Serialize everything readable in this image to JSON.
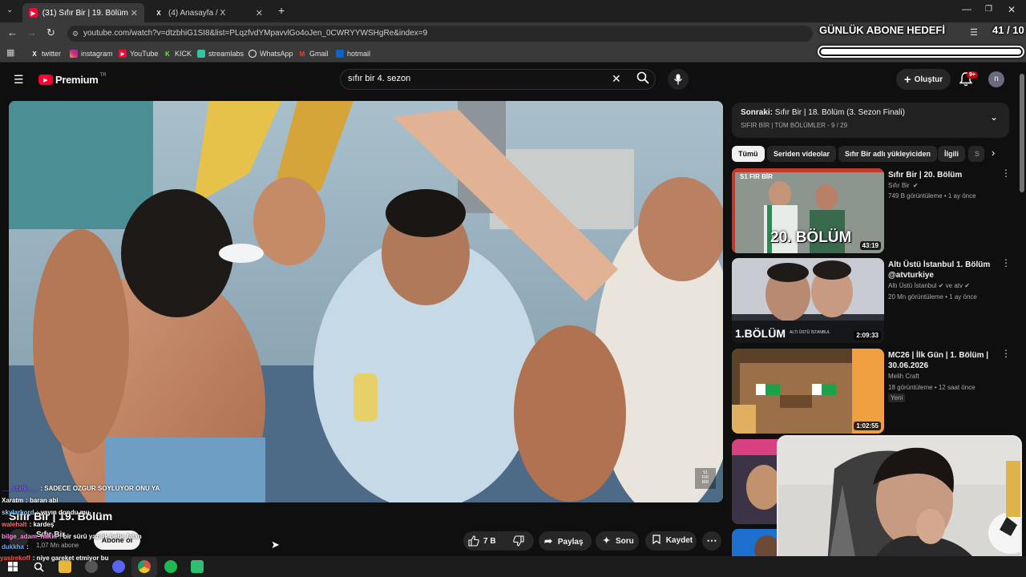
{
  "browser": {
    "tabs": [
      {
        "title": "(31) Sıfır Bir | 19. Bölüm - YouTu",
        "active": true
      },
      {
        "title": "(4) Anasayfa / X",
        "active": false
      }
    ],
    "url": "youtube.com/watch?v=dtzbhiG1SI8&list=PLqzfvdYMpavvlGo4oJen_0CWRYYWSHgRe&index=9",
    "bookmarks": [
      "twitter",
      "instagram",
      "YouTube",
      "KICK",
      "streamlabs",
      "WhatsApp",
      "Gmail",
      "hotmail"
    ]
  },
  "overlay": {
    "goal_label": "GÜNLÜK ABONE HEDEFİ",
    "goal_count": "41 / 10",
    "goal_progress": 1.0
  },
  "youtube": {
    "logo_text": "Premium",
    "logo_badge": "TR",
    "search_value": "sıfır bir 4. sezon",
    "create_label": "Oluştur",
    "notif_count": "9+",
    "avatar_letter": "n"
  },
  "video": {
    "watermark_line1": "S1",
    "watermark_line2": "FIR",
    "watermark_line3": "BİR",
    "title": "Sıfır Bir | 19. Bölüm",
    "channel": "Sıfır Bir",
    "subscribers": "1,07 Mn abone",
    "subscribe_label": "Abone ol",
    "likes": "7 B",
    "share_label": "Paylaş",
    "ask_label": "Soru",
    "save_label": "Kaydet"
  },
  "playlist": {
    "next_label": "Sonraki:",
    "next_title": "Sıfır Bir | 18. Bölüm (3. Sezon Finali)",
    "playlist_info": "SIFIR BİR | TÜM BÖLÜMLER - 9 / 29"
  },
  "chips": [
    "Tümü",
    "Seriden videolar",
    "Sıfır Bir adlı yükleyiciden",
    "İlgili",
    "S"
  ],
  "recommendations": [
    {
      "title": "Sıfır Bir | 20. Bölüm",
      "channel": "Sıfır Bir",
      "meta": "749 B görüntüleme • 1 ay önce",
      "duration": "43:19",
      "thumb_text": "20. BÖLÜM",
      "badge": ""
    },
    {
      "title": "Altı Üstü İstanbul 1. Bölüm @atvturkiye",
      "channel": "Altı Üstü İstanbul",
      "channel_suffix": "ve atv",
      "meta": "20 Mn görüntüleme • 1 ay önce",
      "duration": "2:09:33",
      "thumb_text": "1.BÖLÜM",
      "thumb_sub": "ALTI ÜSTÜ İSTANBUL",
      "badge": ""
    },
    {
      "title": "MC26 | İlk Gün | 1. Bölüm | 30.06.2026",
      "channel": "Melih Craft",
      "meta": "18 görüntüleme • 12 saat önce",
      "duration": "1:02:55",
      "thumb_text": "",
      "badge": "Yeni"
    }
  ],
  "chat": [
    {
      "user": "___xtxtk___",
      "msg": ": SADECE OZGUR SOYLUYOR ONU YA",
      "color": "#8a5cff"
    },
    {
      "user": "Xaratm",
      "msg": ": baran abi",
      "color": "#ffffff"
    },
    {
      "user": "skylarkord",
      "msg": ": yayın dondu mu",
      "color": "#7fd0ff"
    },
    {
      "user": "walehalt",
      "msg": ": kardeş",
      "color": "#ff6a6a"
    },
    {
      "user": "bilge_adam_hakkı",
      "msg": ": bir sürü yazılık bebe falan",
      "color": "#ff8ce0"
    },
    {
      "user": "dukkha",
      "msg": ":",
      "color": "#6aa8ff"
    },
    {
      "user": "yasirekoff",
      "msg": ": niye gareket etmiyor bu",
      "color": "#ff4f4f"
    }
  ],
  "colors": {
    "yt_red": "#ff0033",
    "bg": "#0f0f0f",
    "chip_bg": "#272727"
  }
}
